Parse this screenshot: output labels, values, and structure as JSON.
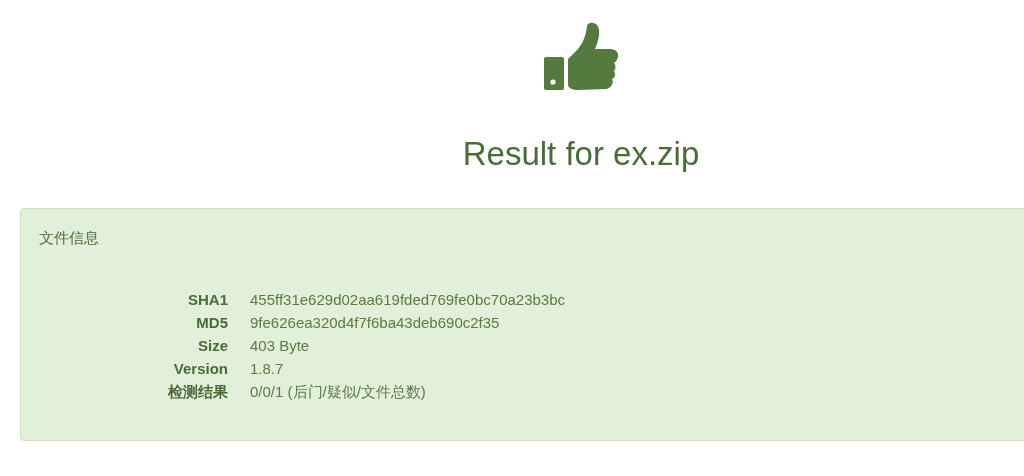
{
  "heading": "Result for ex.zip",
  "panel": {
    "title": "文件信息",
    "rows": [
      {
        "label": "SHA1",
        "value": "455ff31e629d02aa619fded769fe0bc70a23b3bc"
      },
      {
        "label": "MD5",
        "value": "9fe626ea320d4f7f6ba43deb690c2f35"
      },
      {
        "label": "Size",
        "value": "403 Byte"
      },
      {
        "label": "Version",
        "value": "1.8.7"
      },
      {
        "label": "检测结果",
        "value": "0/0/1 (后门/疑似/文件总数)"
      }
    ]
  }
}
